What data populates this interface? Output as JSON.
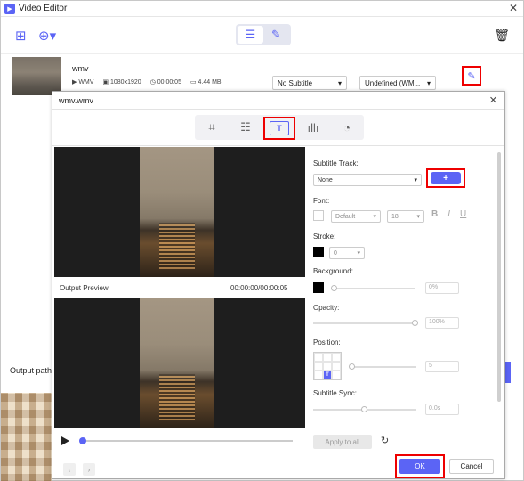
{
  "window": {
    "title": "Video Editor",
    "close_glyph": "✕"
  },
  "toolbar": {
    "add_file_icon": "add-file-icon",
    "add_dropdown_icon": "add-dropdown-icon",
    "view_list_icon": "list-icon",
    "view_edit_icon": "notes-icon",
    "trash_icon": "trash-icon"
  },
  "file": {
    "name": "wmv",
    "format": "WMV",
    "resolution": "1080x1920",
    "duration": "00:00:05",
    "size": "4.44 MB",
    "subtitle_select": "No Subtitle",
    "audio_select": "Undefined (WM..."
  },
  "main": {
    "output_path_label": "Output path:"
  },
  "dialog": {
    "title": "wmv.wmv",
    "tabs": [
      "crop",
      "effects",
      "subtitle",
      "audio",
      "speed"
    ],
    "output_preview_label": "Output Preview",
    "preview_time": "00:00:00/00:00:05",
    "panel": {
      "subtitle_track_label": "Subtitle Track:",
      "subtitle_track_value": "None",
      "add_button": "+",
      "font_label": "Font:",
      "font_family": "Default",
      "font_size": "18",
      "bold": "B",
      "italic": "I",
      "underline": "U",
      "stroke_label": "Stroke:",
      "stroke_value": "0",
      "background_label": "Background:",
      "background_value": "0%",
      "opacity_label": "Opacity:",
      "opacity_value": "100%",
      "position_label": "Position:",
      "position_value": "5",
      "position_marker": "T",
      "subtitle_sync_label": "Subtitle Sync:",
      "subtitle_sync_value": "0.0s",
      "apply_all": "Apply to all"
    },
    "ok": "OK",
    "cancel": "Cancel"
  },
  "colors": {
    "accent": "#5b64f5",
    "highlight": "#e00000"
  }
}
